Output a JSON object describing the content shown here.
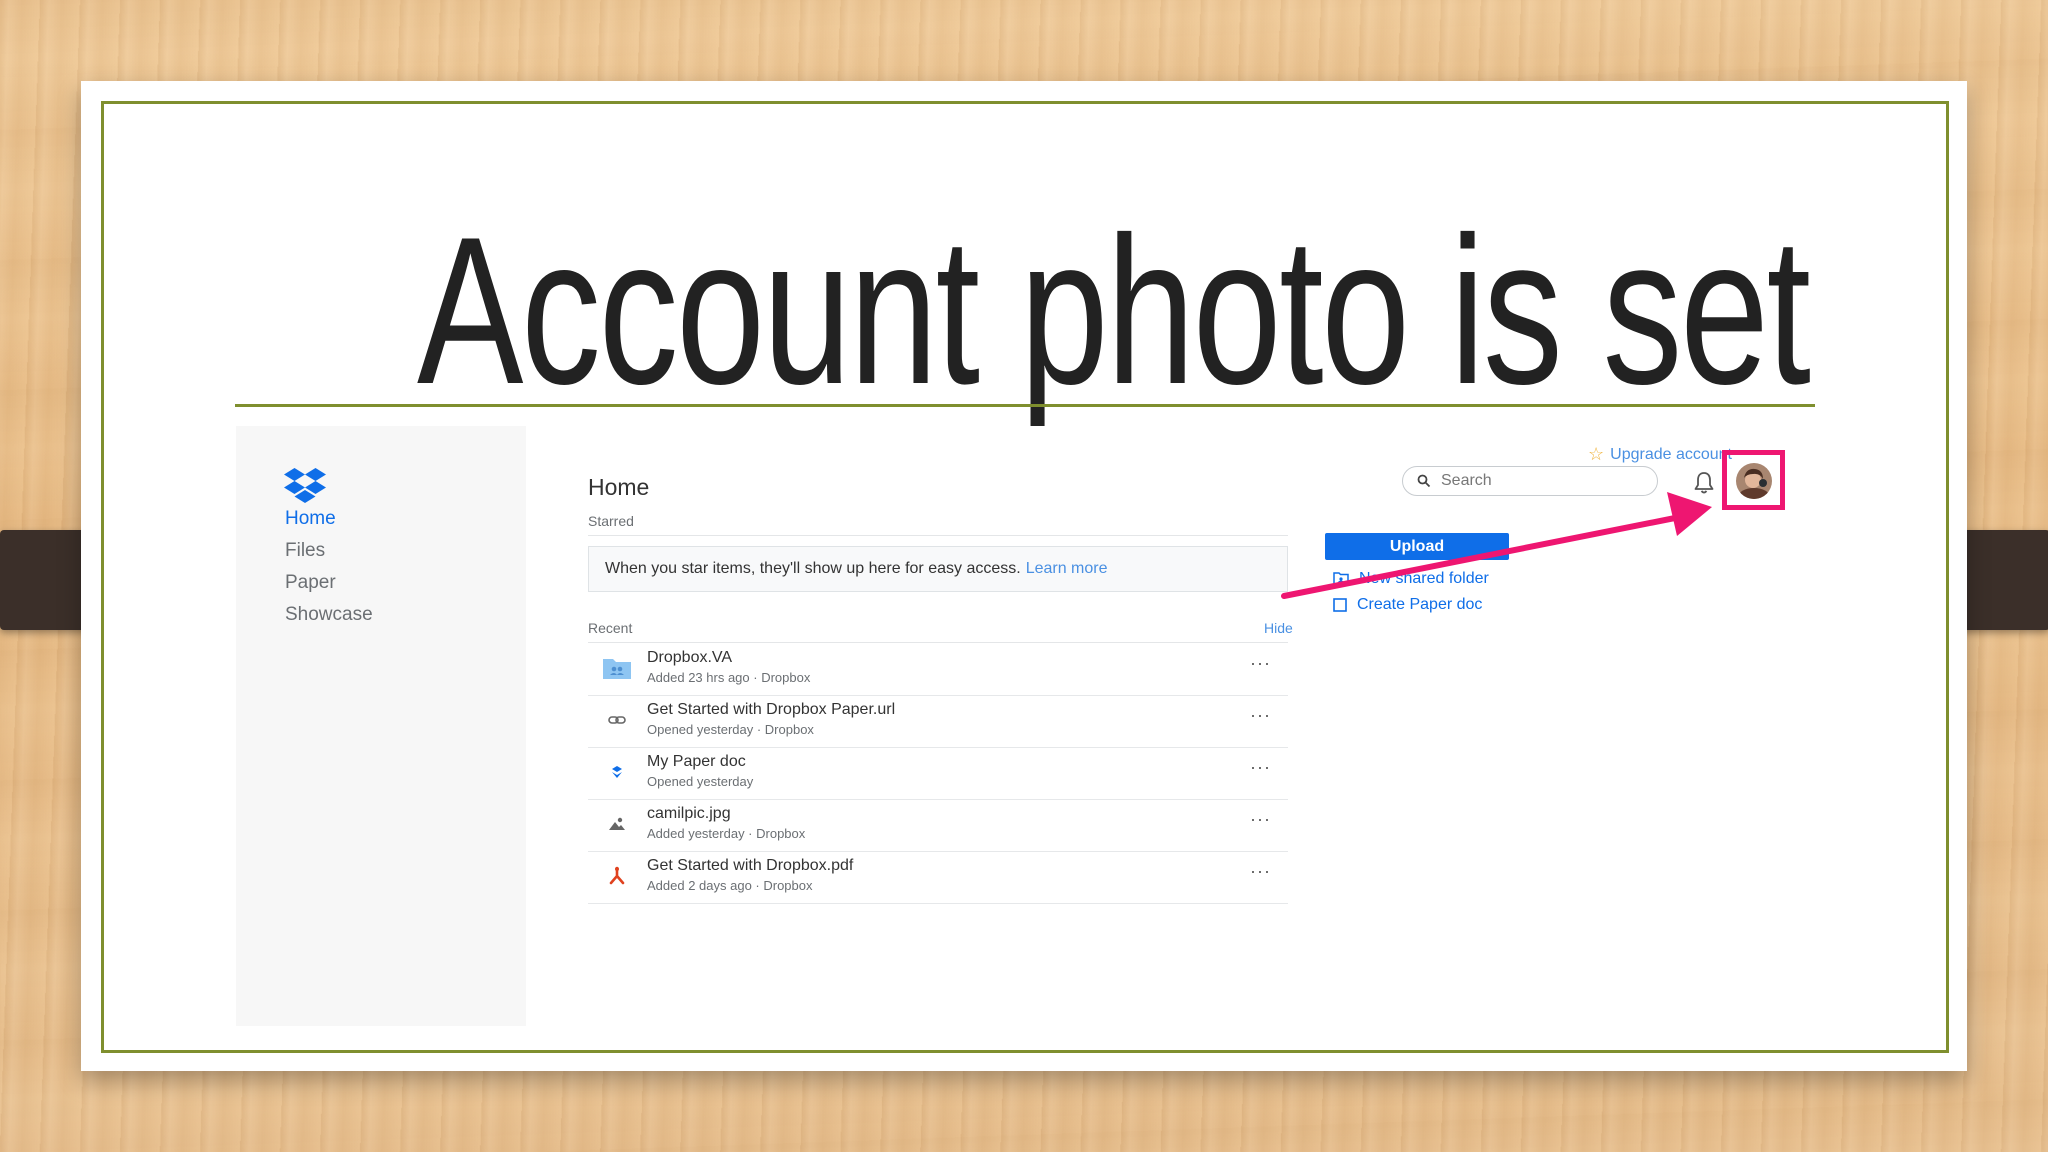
{
  "slide": {
    "title": "Account photo is set"
  },
  "sidebar": {
    "items": [
      {
        "label": "Home",
        "active": true
      },
      {
        "label": "Files",
        "active": false
      },
      {
        "label": "Paper",
        "active": false
      },
      {
        "label": "Showcase",
        "active": false
      }
    ]
  },
  "header": {
    "title": "Home",
    "upgrade_label": "Upgrade account",
    "search_placeholder": "Search"
  },
  "starred": {
    "label": "Starred",
    "message": "When you star items, they'll show up here for easy access.",
    "learn_more": "Learn more"
  },
  "recent": {
    "label": "Recent",
    "hide_label": "Hide",
    "items": [
      {
        "name": "Dropbox.VA",
        "meta": "Added 23 hrs ago · Dropbox",
        "icon": "shared-folder-icon"
      },
      {
        "name": "Get Started with Dropbox Paper.url",
        "meta": "Opened yesterday · Dropbox",
        "icon": "link-icon"
      },
      {
        "name": "My Paper doc",
        "meta": "Opened yesterday",
        "icon": "paper-doc-icon"
      },
      {
        "name": "camilpic.jpg",
        "meta": "Added yesterday · Dropbox",
        "icon": "image-icon"
      },
      {
        "name": "Get Started with Dropbox.pdf",
        "meta": "Added 2 days ago · Dropbox",
        "icon": "pdf-icon"
      }
    ],
    "more_label": "···"
  },
  "actions": {
    "upload_label": "Upload",
    "new_shared_folder_label": "New shared folder",
    "create_paper_doc_label": "Create Paper doc"
  },
  "colors": {
    "accent": "#0f6ee8",
    "highlight": "#ee1671",
    "frame": "#7f8f2e"
  }
}
